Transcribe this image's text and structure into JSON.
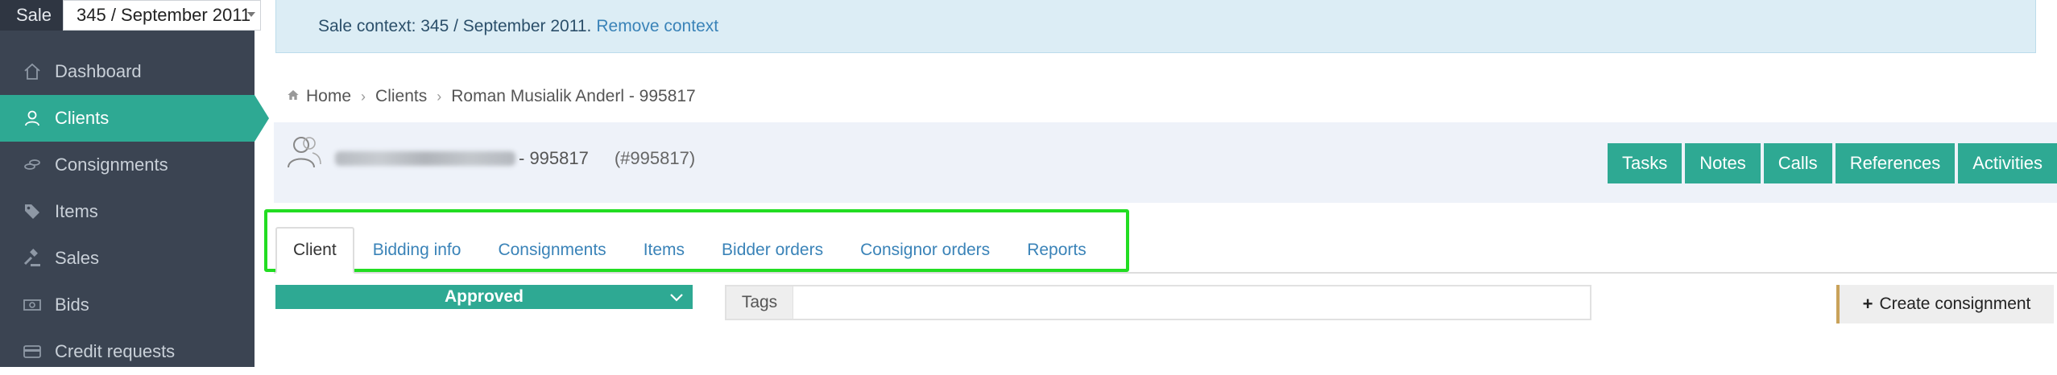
{
  "sidebar": {
    "sale_label": "Sale",
    "sale_value": "345 / September 2011",
    "items": [
      {
        "label": "Dashboard",
        "icon": "home-icon",
        "active": false
      },
      {
        "label": "Clients",
        "icon": "user-icon",
        "active": true
      },
      {
        "label": "Consignments",
        "icon": "coins-icon",
        "active": false
      },
      {
        "label": "Items",
        "icon": "tag-icon",
        "active": false
      },
      {
        "label": "Sales",
        "icon": "gavel-icon",
        "active": false
      },
      {
        "label": "Bids",
        "icon": "money-icon",
        "active": false
      },
      {
        "label": "Credit requests",
        "icon": "credit-card-icon",
        "active": false
      }
    ]
  },
  "context": {
    "text": "Sale context: 345 / September 2011.",
    "link": "Remove context"
  },
  "breadcrumb": {
    "home": "Home",
    "clients": "Clients",
    "current": "Roman Musialik Anderl - 995817"
  },
  "client": {
    "name_suffix": "- 995817",
    "id": "(#995817)"
  },
  "actions": [
    "Tasks",
    "Notes",
    "Calls",
    "References",
    "Activities"
  ],
  "tabs": [
    "Client",
    "Bidding info",
    "Consignments",
    "Items",
    "Bidder orders",
    "Consignor orders",
    "Reports"
  ],
  "status": {
    "value": "Approved"
  },
  "tags": {
    "label": "Tags",
    "value": ""
  },
  "create_button": "Create consignment",
  "colors": {
    "accent": "#2ea993",
    "sidebar": "#3b4452",
    "link": "#3a83b8",
    "highlight": "#22dd22"
  }
}
